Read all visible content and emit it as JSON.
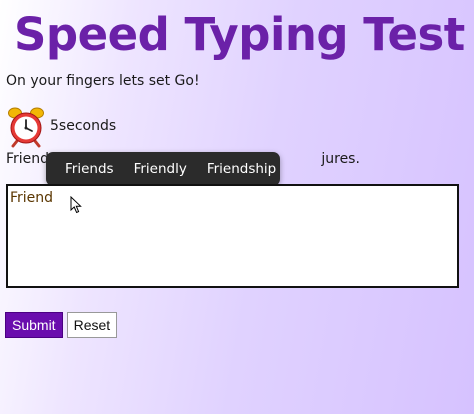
{
  "app": {
    "title": "Speed Typing Test",
    "subtitle": "On your fingers lets set Go!"
  },
  "timer": {
    "icon": "alarm-clock-icon",
    "text": "5seconds"
  },
  "sentence": {
    "left": "Friends",
    "right": "jures."
  },
  "suggestions": [
    "Friends",
    "Friendly",
    "Friendship"
  ],
  "typing_area": {
    "value": "Friend"
  },
  "buttons": {
    "submit": "Submit",
    "reset": "Reset"
  },
  "colors": {
    "title": "#6b21a8",
    "submit_bg": "#6a0dad",
    "suggestion_bg": "#2b2b2b"
  }
}
